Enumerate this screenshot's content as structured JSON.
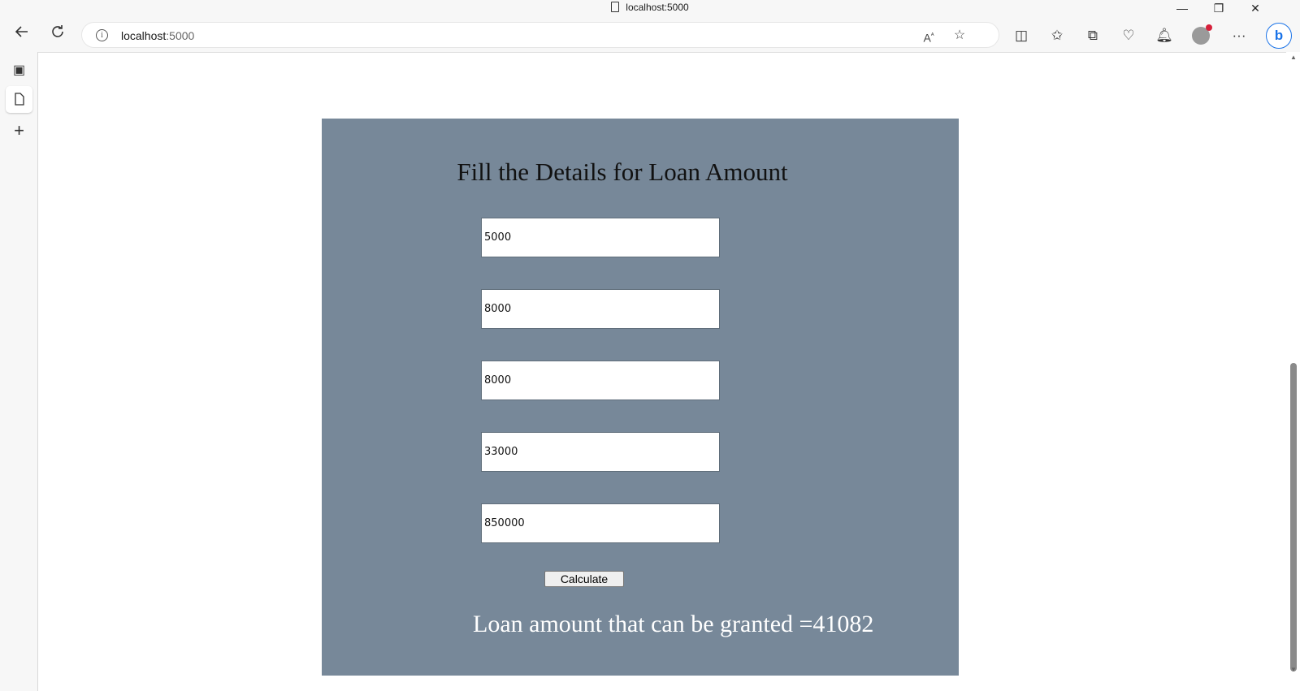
{
  "browser": {
    "tab_title": "localhost:5000",
    "url_host": "localhost",
    "url_port": ":5000",
    "controls": {
      "minimize": "—",
      "restore": "❐",
      "close": "✕"
    }
  },
  "page": {
    "heading": "Fill the Details for Loan Amount",
    "fields": [
      {
        "value": "5000"
      },
      {
        "value": "8000"
      },
      {
        "value": "8000"
      },
      {
        "value": "33000"
      },
      {
        "value": "850000"
      }
    ],
    "button_label": "Calculate",
    "result_text": "Loan amount that can be granted =41082",
    "card_color": "#778899"
  }
}
